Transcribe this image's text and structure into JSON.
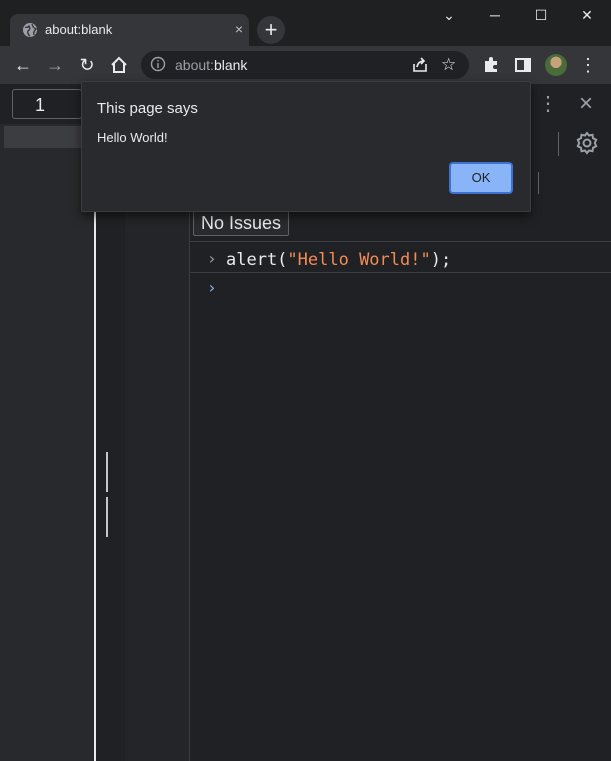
{
  "browser": {
    "tab": {
      "title": "about:blank",
      "close_glyph": "×"
    },
    "new_tab_glyph": "+",
    "window_controls": {
      "minimize": "─",
      "maximize": "☐",
      "close": "✕",
      "tab_search": "⌄"
    },
    "toolbar": {
      "back": "←",
      "forward": "→",
      "reload": "↻",
      "omnibox": {
        "scheme": "about:",
        "rest": "blank"
      }
    }
  },
  "devtools": {
    "line_input_value": "1",
    "issues_button": "No Issues",
    "console": {
      "prompt_glyph": "›",
      "entries": [
        {
          "prefix": "alert(",
          "string": "\"Hello World!\"",
          "suffix": ");"
        }
      ]
    }
  },
  "dialog": {
    "title": "This page says",
    "message": "Hello World!",
    "ok_label": "OK"
  },
  "colors": {
    "background": "#202124",
    "toolbar": "#35363a",
    "string_literal": "#f28b54",
    "ok_button": "#8ab4f8",
    "prompt_active": "#8ab4f8"
  }
}
